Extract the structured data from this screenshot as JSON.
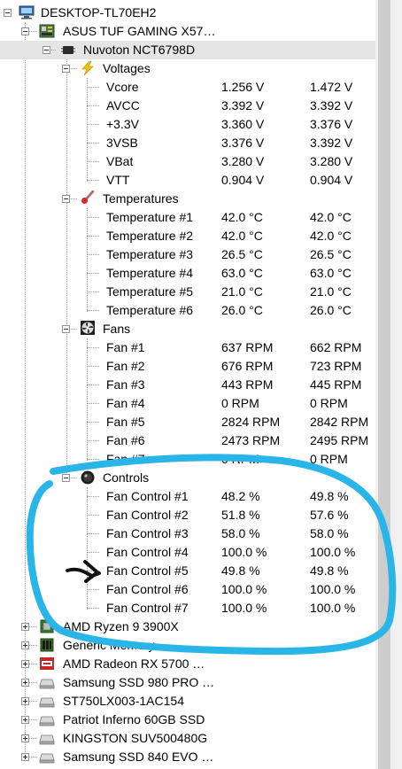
{
  "nodes": {
    "root": "DESKTOP-TL70EH2",
    "mobo": "ASUS TUF GAMING X57…",
    "chip": "Nuvoton NCT6798D",
    "voltages": "Voltages",
    "temperatures": "Temperatures",
    "fans": "Fans",
    "controls": "Controls"
  },
  "voltages": [
    {
      "name": "Vcore",
      "value": "1.256 V",
      "max": "1.472 V"
    },
    {
      "name": "AVCC",
      "value": "3.392 V",
      "max": "3.392 V"
    },
    {
      "name": "+3.3V",
      "value": "3.360 V",
      "max": "3.376 V"
    },
    {
      "name": "3VSB",
      "value": "3.376 V",
      "max": "3.392 V"
    },
    {
      "name": "VBat",
      "value": "3.280 V",
      "max": "3.280 V"
    },
    {
      "name": "VTT",
      "value": "0.904 V",
      "max": "0.904 V"
    }
  ],
  "temperatures": [
    {
      "name": "Temperature #1",
      "value": "42.0 °C",
      "max": "42.0 °C"
    },
    {
      "name": "Temperature #2",
      "value": "42.0 °C",
      "max": "42.0 °C"
    },
    {
      "name": "Temperature #3",
      "value": "26.5 °C",
      "max": "26.5 °C"
    },
    {
      "name": "Temperature #4",
      "value": "63.0 °C",
      "max": "63.0 °C"
    },
    {
      "name": "Temperature #5",
      "value": "21.0 °C",
      "max": "21.0 °C"
    },
    {
      "name": "Temperature #6",
      "value": "26.0 °C",
      "max": "26.0 °C"
    }
  ],
  "fans": [
    {
      "name": "Fan #1",
      "value": "637 RPM",
      "max": "662 RPM"
    },
    {
      "name": "Fan #2",
      "value": "676 RPM",
      "max": "723 RPM"
    },
    {
      "name": "Fan #3",
      "value": "443 RPM",
      "max": "445 RPM"
    },
    {
      "name": "Fan #4",
      "value": "0 RPM",
      "max": "0 RPM"
    },
    {
      "name": "Fan #5",
      "value": "2824 RPM",
      "max": "2842 RPM"
    },
    {
      "name": "Fan #6",
      "value": "2473 RPM",
      "max": "2495 RPM"
    },
    {
      "name": "Fan #7",
      "value": "0 RPM",
      "max": "0 RPM"
    }
  ],
  "controls": [
    {
      "name": "Fan Control #1",
      "value": "48.2 %",
      "max": "49.8 %"
    },
    {
      "name": "Fan Control #2",
      "value": "51.8 %",
      "max": "57.6 %"
    },
    {
      "name": "Fan Control #3",
      "value": "58.0 %",
      "max": "58.0 %"
    },
    {
      "name": "Fan Control #4",
      "value": "100.0 %",
      "max": "100.0 %"
    },
    {
      "name": "Fan Control #5",
      "value": "49.8 %",
      "max": "49.8 %"
    },
    {
      "name": "Fan Control #6",
      "value": "100.0 %",
      "max": "100.0 %"
    },
    {
      "name": "Fan Control #7",
      "value": "100.0 %",
      "max": "100.0 %"
    }
  ],
  "devices": [
    {
      "name": "AMD Ryzen 9 3900X",
      "icon": "cpu-icon"
    },
    {
      "name": "Generic Memory",
      "icon": "memory-icon"
    },
    {
      "name": "AMD Radeon RX 5700 …",
      "icon": "gpu-icon"
    },
    {
      "name": "Samsung SSD 980 PRO …",
      "icon": "drive-icon"
    },
    {
      "name": "ST750LX003-1AC154",
      "icon": "drive-icon"
    },
    {
      "name": "Patriot Inferno 60GB SSD",
      "icon": "drive-icon"
    },
    {
      "name": "KINGSTON SUV500480G",
      "icon": "drive-icon"
    },
    {
      "name": "Samsung SSD 840 EVO …",
      "icon": "drive-icon"
    }
  ],
  "colors": {
    "selection": "#e5e5e5",
    "annotation": "#29b5e8",
    "tree_lines": "#a0a0a0"
  }
}
